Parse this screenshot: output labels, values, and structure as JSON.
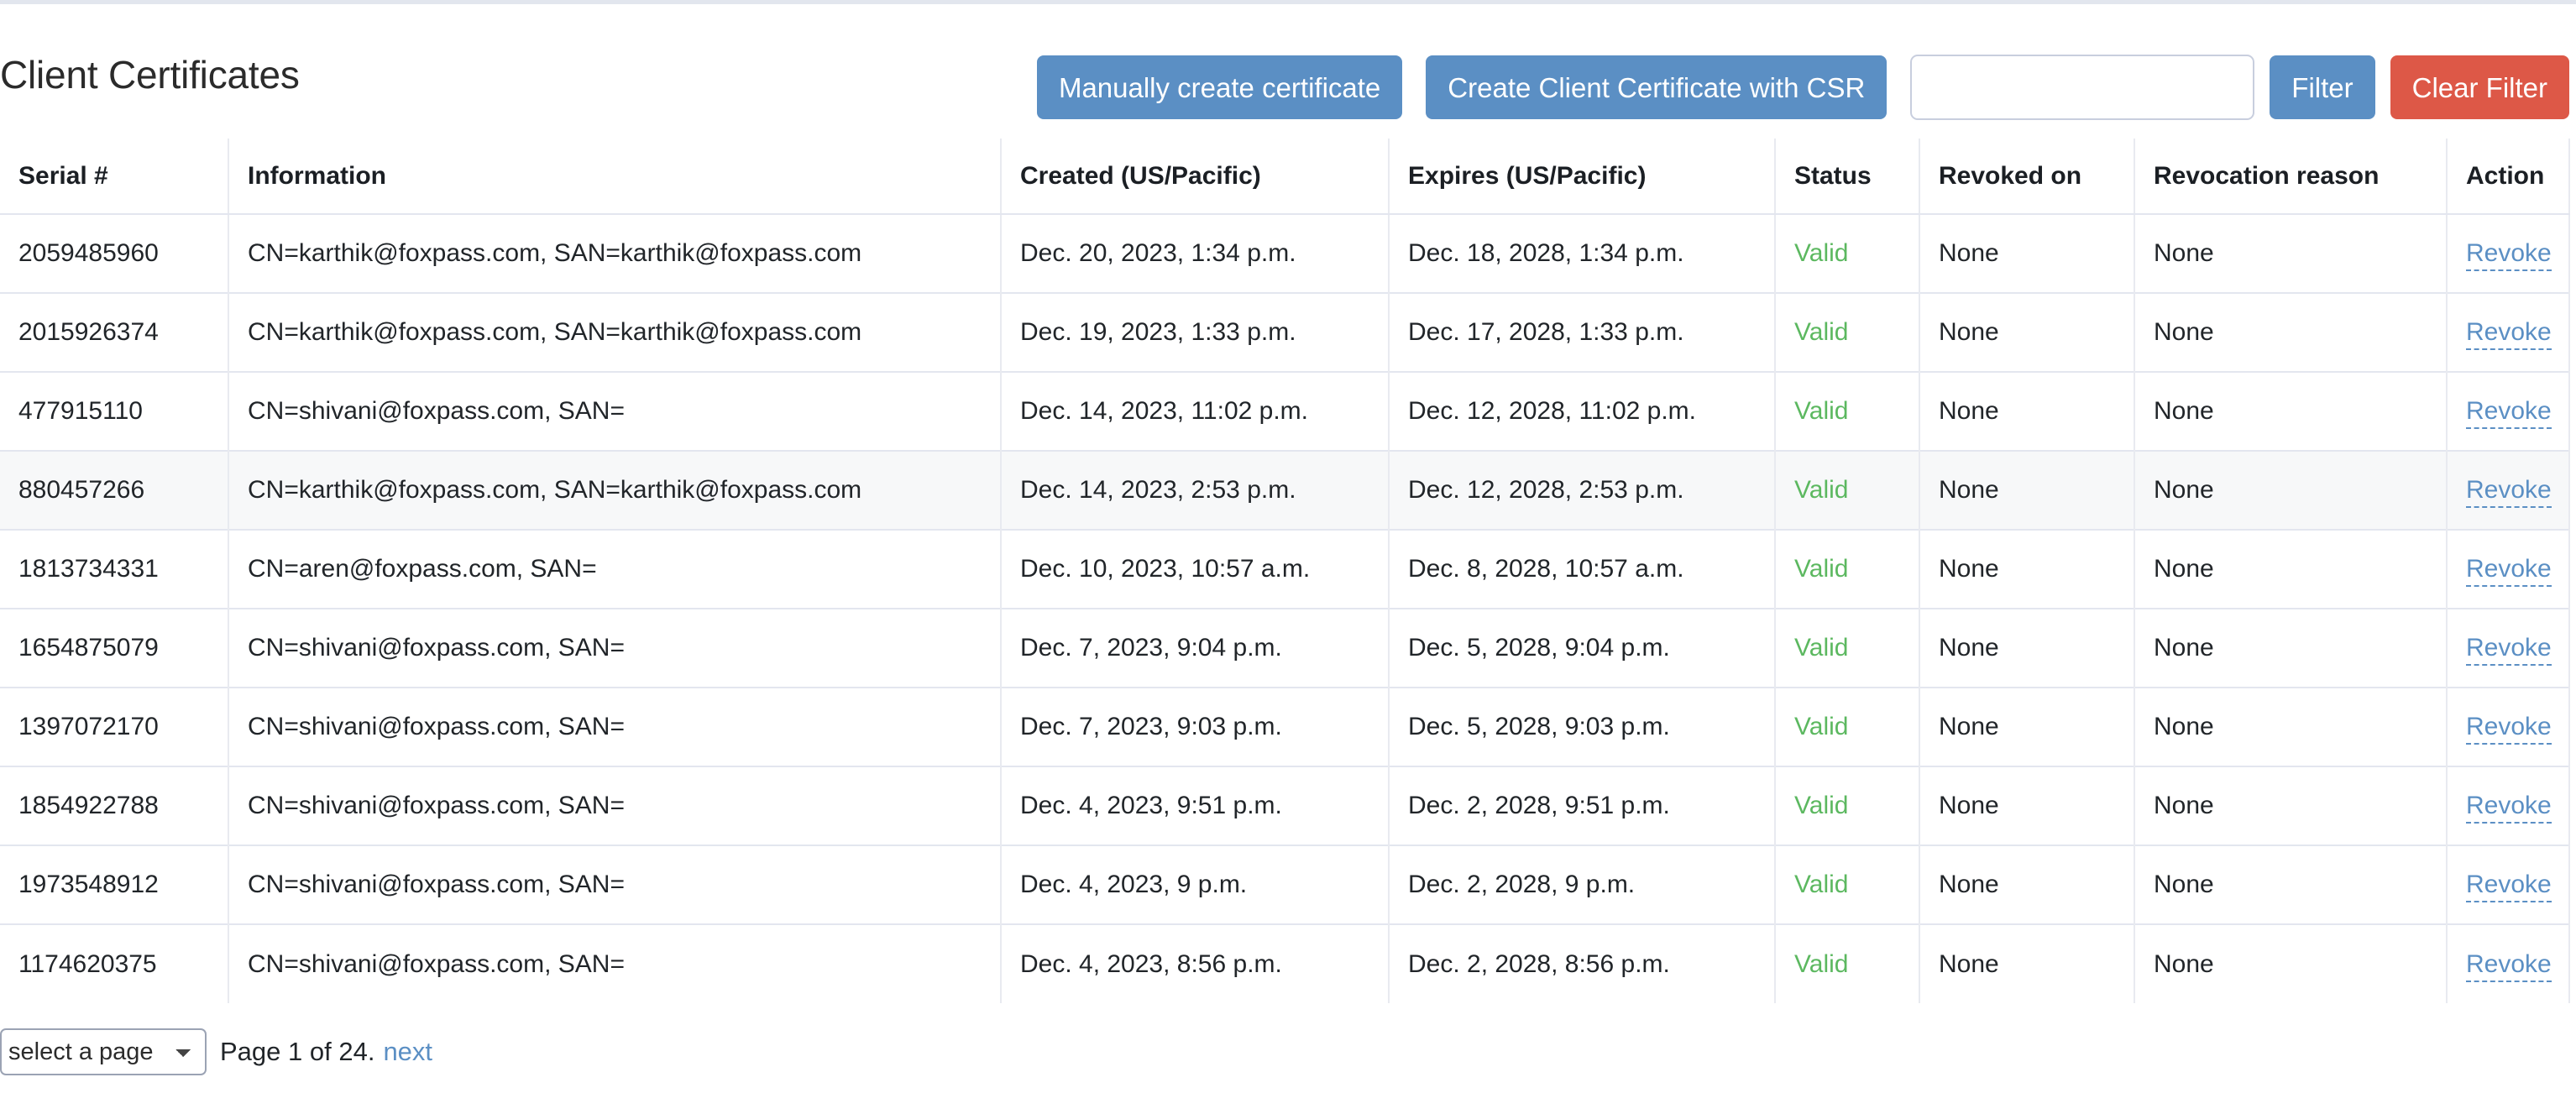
{
  "header": {
    "title": "Client Certificates",
    "manual_create_label": "Manually create certificate",
    "create_csr_label": "Create Client Certificate with CSR",
    "filter_input_value": "",
    "filter_input_placeholder": "",
    "filter_label": "Filter",
    "clear_filter_label": "Clear Filter"
  },
  "colors": {
    "primary": "#5b8fc4",
    "danger": "#dd5847",
    "status_valid": "#5cb860",
    "link": "#5b8fc4",
    "row_hover": "#f7f8f9",
    "border": "#e3e6ef"
  },
  "table": {
    "columns": [
      "Serial #",
      "Information",
      "Created (US/Pacific)",
      "Expires (US/Pacific)",
      "Status",
      "Revoked on",
      "Revocation reason",
      "Action"
    ],
    "action_label": "Revoke",
    "rows": [
      {
        "serial": "2059485960",
        "information": "CN=karthik@foxpass.com, SAN=karthik@foxpass.com",
        "created": "Dec. 20, 2023, 1:34 p.m.",
        "expires": "Dec. 18, 2028, 1:34 p.m.",
        "status": "Valid",
        "revoked_on": "None",
        "revocation_reason": "None",
        "action": "Revoke",
        "hover": false
      },
      {
        "serial": "2015926374",
        "information": "CN=karthik@foxpass.com, SAN=karthik@foxpass.com",
        "created": "Dec. 19, 2023, 1:33 p.m.",
        "expires": "Dec. 17, 2028, 1:33 p.m.",
        "status": "Valid",
        "revoked_on": "None",
        "revocation_reason": "None",
        "action": "Revoke",
        "hover": false
      },
      {
        "serial": "477915110",
        "information": "CN=shivani@foxpass.com, SAN=",
        "created": "Dec. 14, 2023, 11:02 p.m.",
        "expires": "Dec. 12, 2028, 11:02 p.m.",
        "status": "Valid",
        "revoked_on": "None",
        "revocation_reason": "None",
        "action": "Revoke",
        "hover": false
      },
      {
        "serial": "880457266",
        "information": "CN=karthik@foxpass.com, SAN=karthik@foxpass.com",
        "created": "Dec. 14, 2023, 2:53 p.m.",
        "expires": "Dec. 12, 2028, 2:53 p.m.",
        "status": "Valid",
        "revoked_on": "None",
        "revocation_reason": "None",
        "action": "Revoke",
        "hover": true
      },
      {
        "serial": "1813734331",
        "information": "CN=aren@foxpass.com, SAN=",
        "created": "Dec. 10, 2023, 10:57 a.m.",
        "expires": "Dec. 8, 2028, 10:57 a.m.",
        "status": "Valid",
        "revoked_on": "None",
        "revocation_reason": "None",
        "action": "Revoke",
        "hover": false
      },
      {
        "serial": "1654875079",
        "information": "CN=shivani@foxpass.com, SAN=",
        "created": "Dec. 7, 2023, 9:04 p.m.",
        "expires": "Dec. 5, 2028, 9:04 p.m.",
        "status": "Valid",
        "revoked_on": "None",
        "revocation_reason": "None",
        "action": "Revoke",
        "hover": false
      },
      {
        "serial": "1397072170",
        "information": "CN=shivani@foxpass.com, SAN=",
        "created": "Dec. 7, 2023, 9:03 p.m.",
        "expires": "Dec. 5, 2028, 9:03 p.m.",
        "status": "Valid",
        "revoked_on": "None",
        "revocation_reason": "None",
        "action": "Revoke",
        "hover": false
      },
      {
        "serial": "1854922788",
        "information": "CN=shivani@foxpass.com, SAN=",
        "created": "Dec. 4, 2023, 9:51 p.m.",
        "expires": "Dec. 2, 2028, 9:51 p.m.",
        "status": "Valid",
        "revoked_on": "None",
        "revocation_reason": "None",
        "action": "Revoke",
        "hover": false
      },
      {
        "serial": "1973548912",
        "information": "CN=shivani@foxpass.com, SAN=",
        "created": "Dec. 4, 2023, 9 p.m.",
        "expires": "Dec. 2, 2028, 9 p.m.",
        "status": "Valid",
        "revoked_on": "None",
        "revocation_reason": "None",
        "action": "Revoke",
        "hover": false
      },
      {
        "serial": "1174620375",
        "information": "CN=shivani@foxpass.com, SAN=",
        "created": "Dec. 4, 2023, 8:56 p.m.",
        "expires": "Dec. 2, 2028, 8:56 p.m.",
        "status": "Valid",
        "revoked_on": "None",
        "revocation_reason": "None",
        "action": "Revoke",
        "hover": false
      }
    ]
  },
  "footer": {
    "page_select_value": "select a page",
    "page_select_options": [
      "select a page"
    ],
    "page_info": "Page 1 of 24.",
    "next_label": "next"
  }
}
